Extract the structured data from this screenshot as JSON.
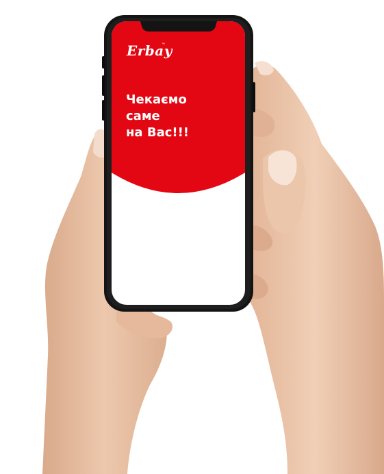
{
  "brand": {
    "logo_text": "Erbay",
    "trademark": "™"
  },
  "screen": {
    "headline_lines": [
      "Чекаємо",
      "саме",
      "на Вас!!!"
    ]
  },
  "colors": {
    "brand_red": "#e30613",
    "screen_white": "#ffffff",
    "phone_body": "#141414",
    "skin": "#e8c0a4"
  }
}
